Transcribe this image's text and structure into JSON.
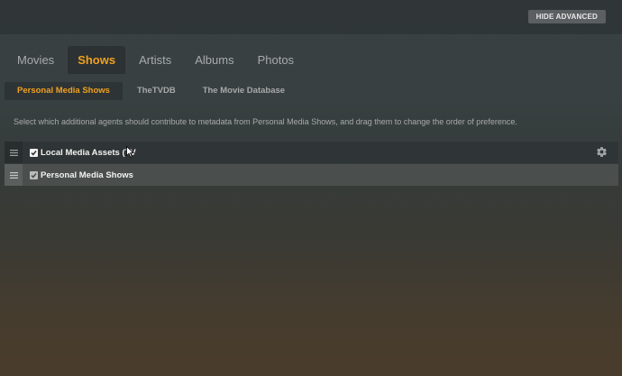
{
  "header": {
    "hide_advanced_label": "HIDE ADVANCED"
  },
  "tabs": [
    {
      "label": "Movies"
    },
    {
      "label": "Shows"
    },
    {
      "label": "Artists"
    },
    {
      "label": "Albums"
    },
    {
      "label": "Photos"
    }
  ],
  "active_tab": "Shows",
  "subtabs": [
    {
      "label": "Personal Media Shows"
    },
    {
      "label": "TheTVDB"
    },
    {
      "label": "The Movie Database"
    }
  ],
  "active_subtab": "Personal Media Shows",
  "description": "Select which additional agents should contribute to metadata from Personal Media Shows, and drag them to change the order of preference.",
  "agents": [
    {
      "label": "Local Media Assets (TV",
      "checked": true
    },
    {
      "label": "Personal Media Shows",
      "checked": true
    }
  ],
  "colors": {
    "accent": "#f0a020"
  },
  "icons": {
    "drag": "drag-handle-icon",
    "settings": "gear-icon",
    "check": "checkmark-icon"
  }
}
